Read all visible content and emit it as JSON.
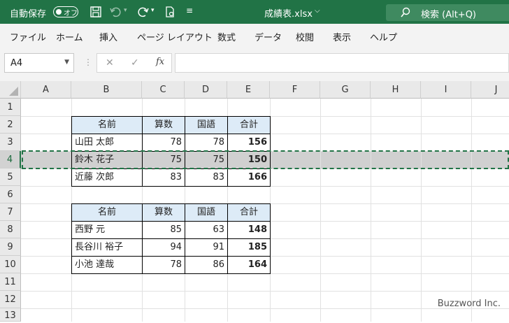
{
  "titlebar": {
    "autosave_label": "自動保存",
    "autosave_state": "オフ",
    "file_name": "成績表.xlsx",
    "search_label": "検索 (Alt+Q)",
    "bg_color": "#217346"
  },
  "menu": [
    "ファイル",
    "ホーム",
    "挿入",
    "ページ レイアウト",
    "数式",
    "データ",
    "校閲",
    "表示",
    "ヘルプ"
  ],
  "formula_bar": {
    "name_box": "A4",
    "fx": "fx",
    "cancel_icon": "✕",
    "enter_icon": "✓",
    "formula": ""
  },
  "columns": [
    "A",
    "B",
    "C",
    "D",
    "E",
    "F",
    "G",
    "H",
    "I",
    "J"
  ],
  "rows": [
    "1",
    "2",
    "3",
    "4",
    "5",
    "6",
    "7",
    "8",
    "9",
    "10",
    "11",
    "12",
    "13"
  ],
  "table1": {
    "headers": [
      "名前",
      "算数",
      "国語",
      "合計"
    ],
    "rows": [
      [
        "山田 太郎",
        "78",
        "78",
        "156"
      ],
      [
        "鈴木 花子",
        "75",
        "75",
        "150"
      ],
      [
        "近藤 次郎",
        "83",
        "83",
        "166"
      ]
    ]
  },
  "table2": {
    "headers": [
      "名前",
      "算数",
      "国語",
      "合計"
    ],
    "rows": [
      [
        "西野 元",
        "85",
        "63",
        "148"
      ],
      [
        "長谷川 裕子",
        "94",
        "91",
        "185"
      ],
      [
        "小池 達哉",
        "78",
        "86",
        "164"
      ]
    ]
  },
  "selected_row": "4",
  "watermark": "Buzzword Inc.",
  "colors": {
    "accent": "#217346",
    "header_fill": "#ddebf7",
    "selection": "#d0d0d0"
  }
}
